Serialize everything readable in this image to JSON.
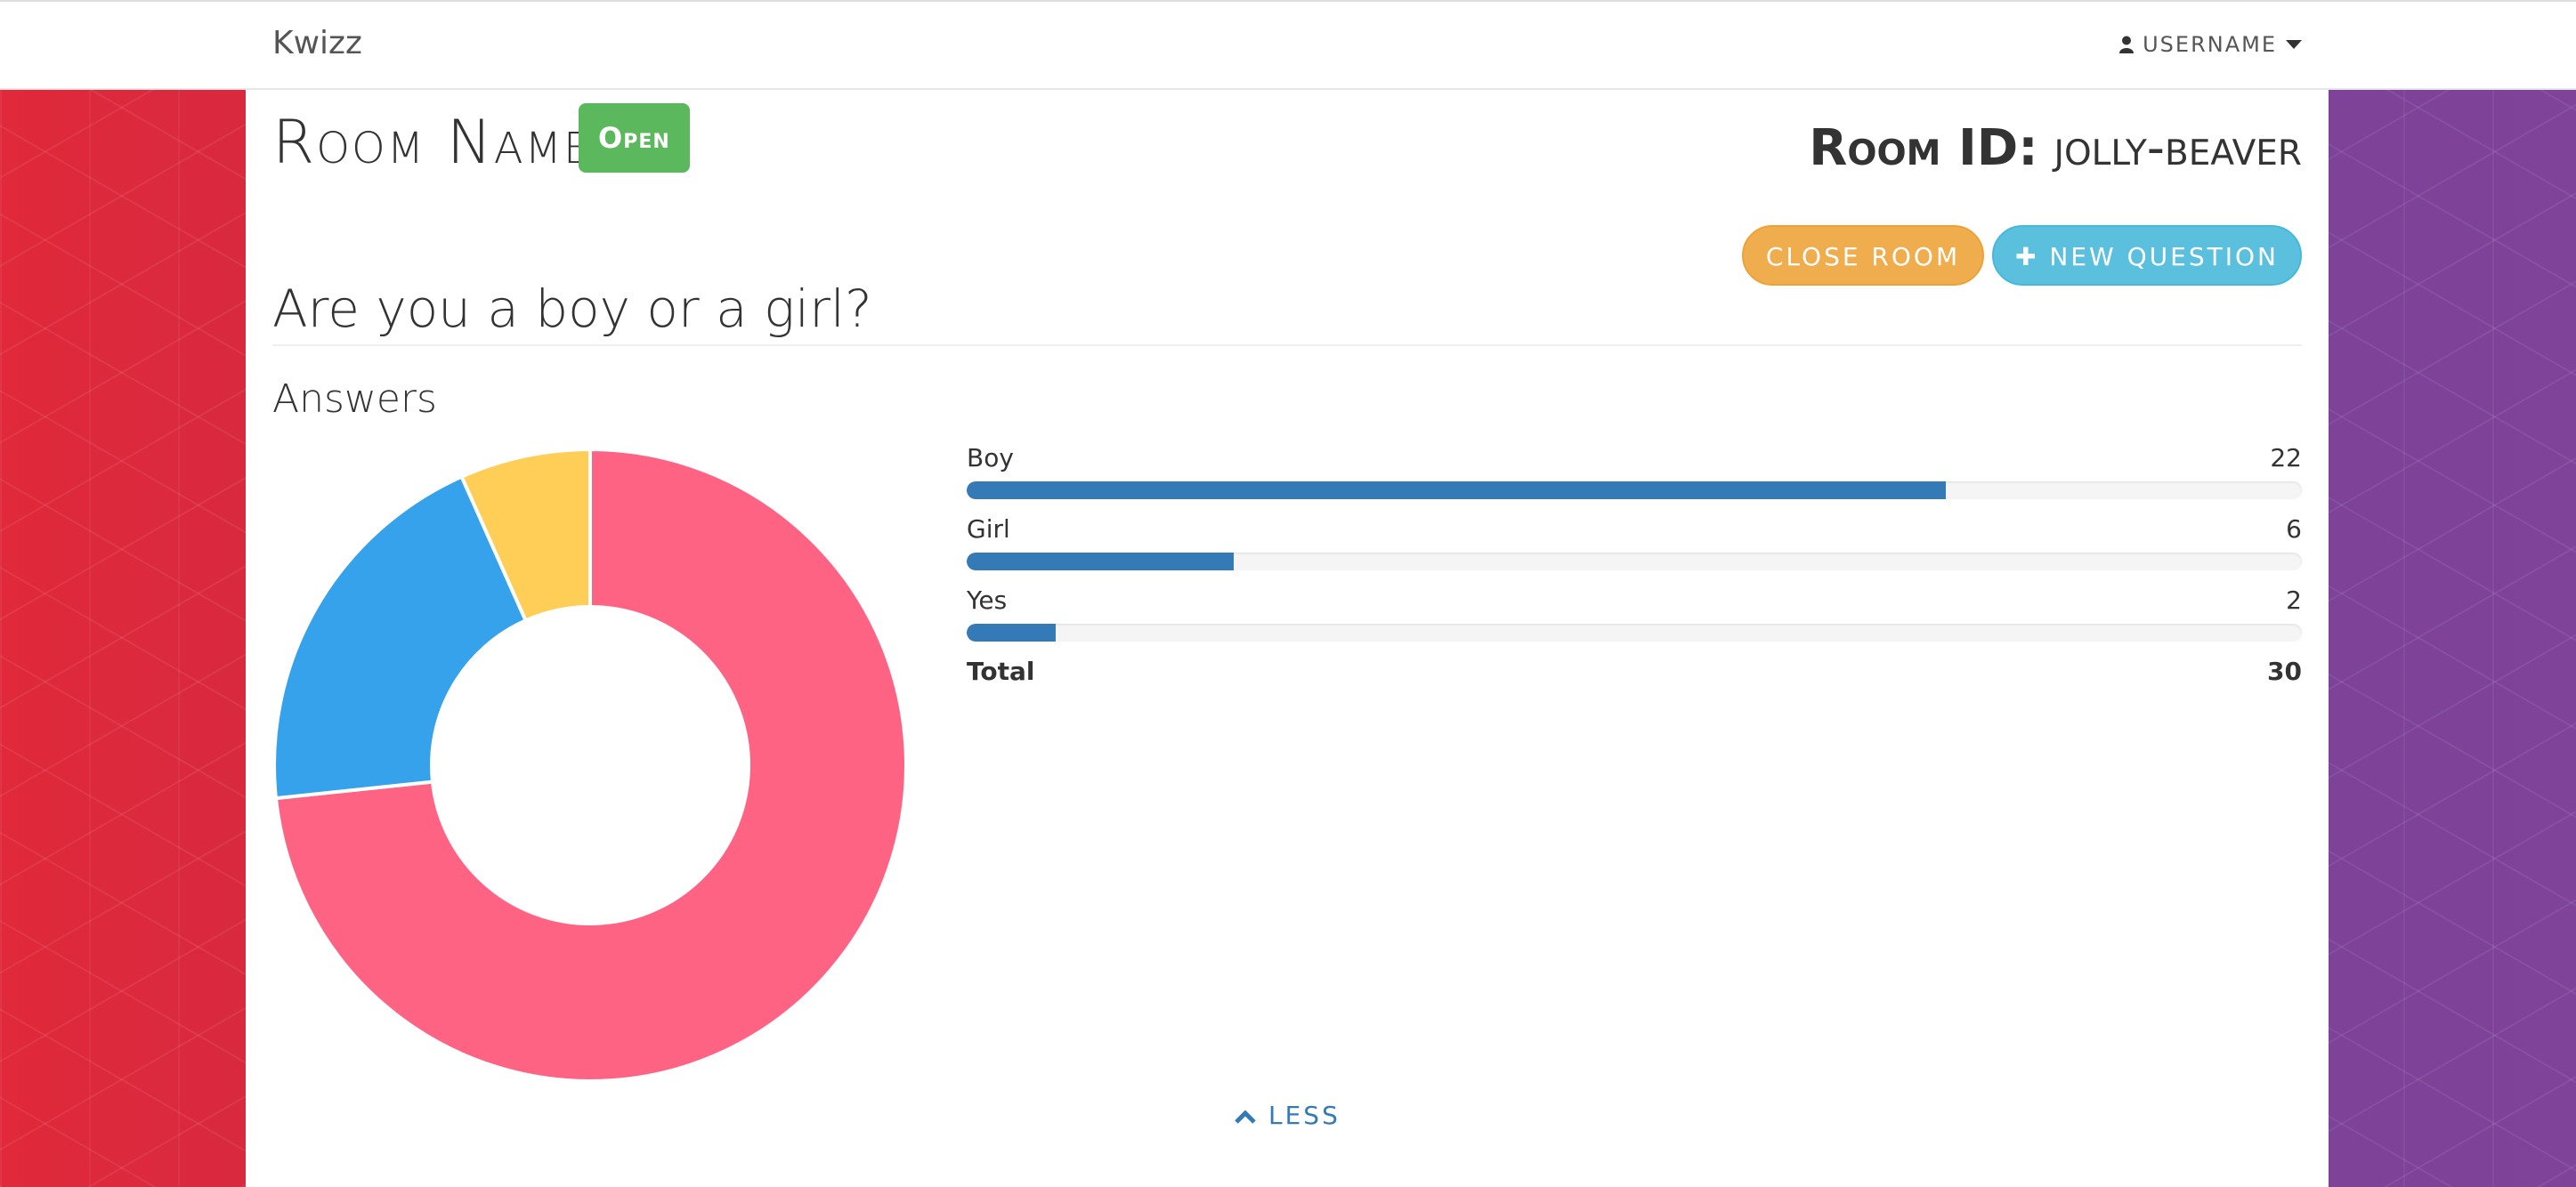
{
  "navbar": {
    "brand": "Kwizz",
    "user": "USERNAME"
  },
  "room": {
    "name": "Room Name",
    "status": "Open",
    "id_label": "Room ID:",
    "id_value": "jolly-beaver"
  },
  "actions": {
    "close_room": "CLOSE ROOM",
    "new_question": "NEW QUESTION"
  },
  "question": {
    "text": "Are you a boy or a girl?"
  },
  "answers": {
    "heading": "Answers",
    "items": [
      {
        "label": "Boy",
        "count": "22",
        "fraction": 0.7333
      },
      {
        "label": "Girl",
        "count": "6",
        "fraction": 0.2
      },
      {
        "label": "Yes",
        "count": "2",
        "fraction": 0.0667
      }
    ],
    "total_label": "Total",
    "total_count": "30"
  },
  "chart_data": {
    "type": "pie",
    "variant": "doughnut",
    "categories": [
      "Boy",
      "Girl",
      "Yes"
    ],
    "values": [
      22,
      6,
      2
    ],
    "colors": [
      "#ff6384",
      "#36a2eb",
      "#ffce56"
    ]
  },
  "footer": {
    "less": "LESS"
  },
  "colors": {
    "open_badge": "#5cb85c",
    "close_button": "#f0ad4e",
    "new_question_button": "#5bc0de",
    "progress_bar": "#337ab7"
  },
  "icons": {
    "user": "user-icon",
    "caret": "caret-down-icon",
    "plus": "plus-icon",
    "chevron": "chevron-up-icon"
  }
}
